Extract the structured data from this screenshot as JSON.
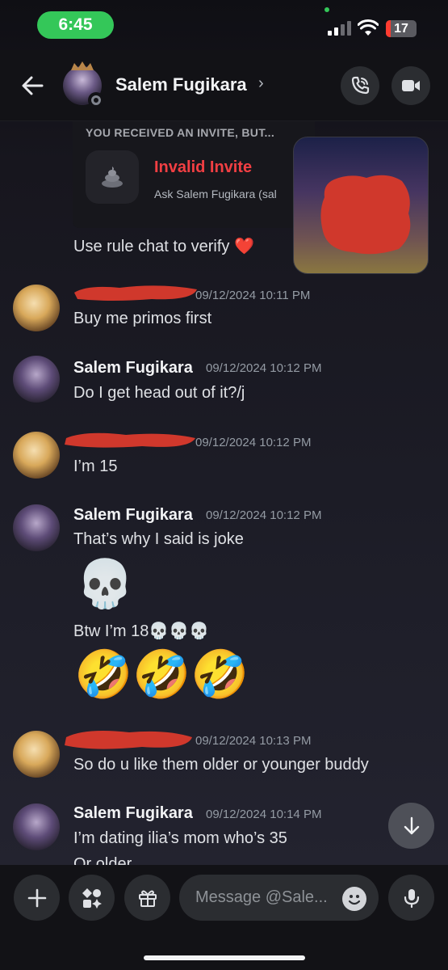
{
  "status_bar": {
    "time": "6:45",
    "battery": "17",
    "battery_level": 0.17
  },
  "header": {
    "title": "Salem Fugikara",
    "chevron": "›"
  },
  "invite": {
    "heading": "YOU RECEIVED AN INVITE, BUT...",
    "name": "Invalid Invite",
    "subtext": "Ask Salem Fugikara (sal"
  },
  "messages": [
    {
      "text": "Use rule chat to verify ❤️"
    },
    {
      "timestamp": "09/12/2024 10:11 PM",
      "text": "Buy me primos first"
    },
    {
      "author": "Salem Fugikara",
      "timestamp": "09/12/2024 10:12 PM",
      "text": "Do I get head out of it?/j"
    },
    {
      "timestamp": "09/12/2024 10:12 PM",
      "text": "I’m 15"
    },
    {
      "author": "Salem Fugikara",
      "timestamp": "09/12/2024 10:12 PM",
      "text": "That’s why I said is joke",
      "emoji": "💀",
      "text2": "Btw I’m 18💀💀💀",
      "emoji2": "🤣🤣🤣"
    },
    {
      "timestamp": "09/12/2024 10:13 PM",
      "text": "So do u like them older or younger buddy"
    },
    {
      "author": "Salem Fugikara",
      "timestamp": "09/12/2024 10:14 PM",
      "text": "I’m dating ilia’s mom who’s 35",
      "peek": "Or older"
    }
  ],
  "composer": {
    "placeholder": "Message @Sale..."
  },
  "colors": {
    "online": "#34c759",
    "error": "#f23f43",
    "redaction": "#d0382c"
  },
  "icons": [
    "back-arrow-icon",
    "phone-call-icon",
    "video-camera-icon",
    "plus-icon",
    "apps-icon",
    "gift-icon",
    "emoji-icon",
    "microphone-icon",
    "arrow-down-icon",
    "wifi-icon",
    "signal-icon",
    "battery-icon"
  ]
}
